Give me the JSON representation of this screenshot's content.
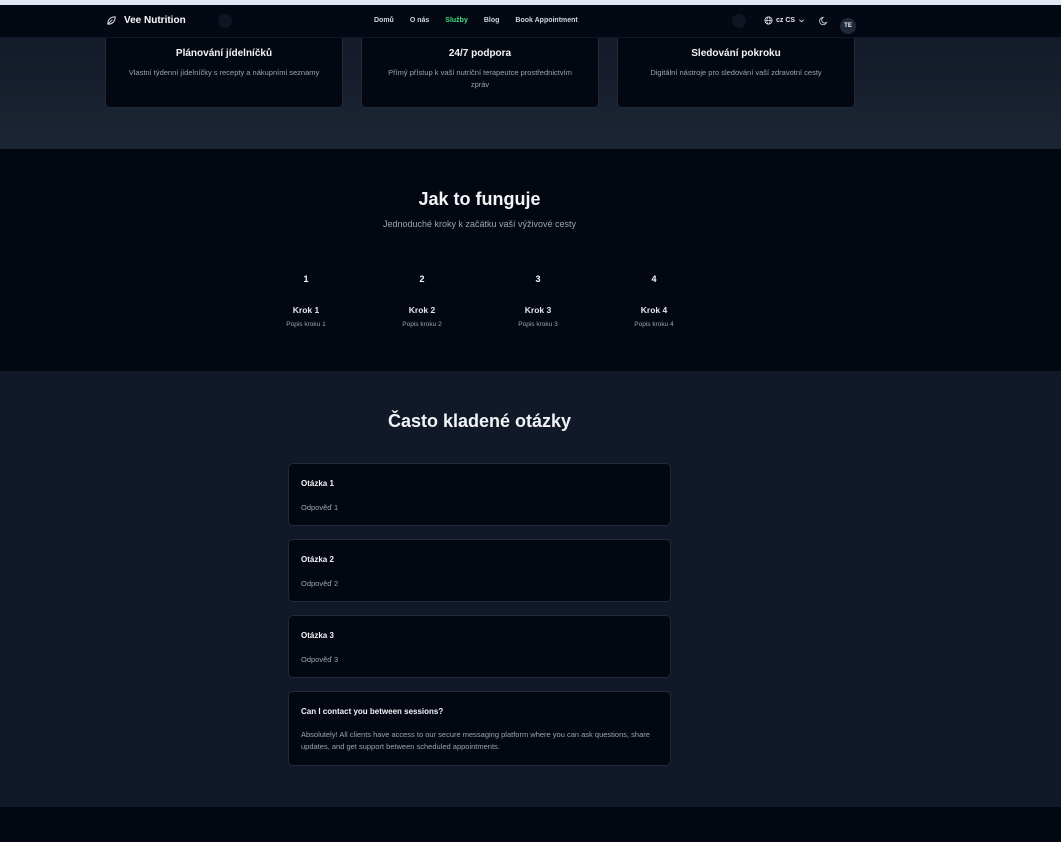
{
  "nav": {
    "brand": "Vee Nutrition",
    "links": [
      "Domů",
      "O nás",
      "Služby",
      "Blog",
      "Book Appointment"
    ],
    "active_link": "Služby",
    "language": "cz CS",
    "avatar_initials": "TE"
  },
  "features": [
    {
      "title": "Plánování jídelníčků",
      "desc": "Vlastní týdenní jídelníčky s recepty a nákupními seznamy"
    },
    {
      "title": "24/7 podpora",
      "desc": "Přímý přístup k vaší nutriční terapeutce prostřednictvím zpráv"
    },
    {
      "title": "Sledování pokroku",
      "desc": "Digitální nástroje pro sledování vaší zdravotní cesty"
    }
  ],
  "how": {
    "title": "Jak to funguje",
    "subtitle": "Jednoduché kroky k začátku vaší výživové cesty",
    "steps": [
      {
        "num": "1",
        "title": "Krok 1",
        "desc": "Popis kroku 1"
      },
      {
        "num": "2",
        "title": "Krok 2",
        "desc": "Popis kroku 2"
      },
      {
        "num": "3",
        "title": "Krok 3",
        "desc": "Popis kroku 3"
      },
      {
        "num": "4",
        "title": "Krok 4",
        "desc": "Popis kroku 4"
      }
    ]
  },
  "faq": {
    "title": "Často kladené otázky",
    "items": [
      {
        "q": "Otázka 1",
        "a": "Odpověď 1"
      },
      {
        "q": "Otázka 2",
        "a": "Odpověď 2"
      },
      {
        "q": "Otázka 3",
        "a": "Odpověď 3"
      },
      {
        "q": "Can I contact you between sessions?",
        "a": "Absolutely! All clients have access to our secure messaging platform where you can ask questions, share updates, and get support between scheduled appointments."
      }
    ]
  },
  "colors": {
    "accent": "#4ade80",
    "background": "#030712",
    "panel": "#111827"
  },
  "icons": {
    "brand": "leaf-icon",
    "language": "globe-icon",
    "language_menu": "chevron-down-icon",
    "theme": "moon-icon"
  }
}
